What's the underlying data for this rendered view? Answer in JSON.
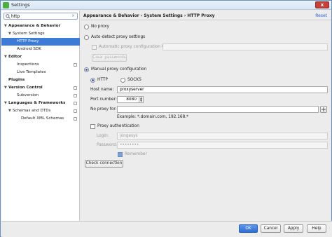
{
  "window": {
    "title": "Settings",
    "close_glyph": "x"
  },
  "search": {
    "value": "http",
    "icon": "search-icon",
    "clear_glyph": "×"
  },
  "tree": [
    {
      "label": "Appearance & Behavior",
      "arrow": "▼",
      "bold": true
    },
    {
      "label": "System Settings",
      "arrow": "▼",
      "bold": false
    },
    {
      "label": "HTTP Proxy",
      "arrow": "",
      "bold": false,
      "selected": true
    },
    {
      "label": "Android SDK",
      "arrow": "",
      "bold": false
    },
    {
      "label": "Editor",
      "arrow": "▼",
      "bold": true
    },
    {
      "label": "Inspections",
      "arrow": "",
      "bold": false,
      "badge": true
    },
    {
      "label": "Live Templates",
      "arrow": "",
      "bold": false
    },
    {
      "label": "Plugins",
      "arrow": "",
      "bold": true
    },
    {
      "label": "Version Control",
      "arrow": "▼",
      "bold": true,
      "badge": true
    },
    {
      "label": "Subversion",
      "arrow": "",
      "bold": false,
      "badge": true
    },
    {
      "label": "Languages & Frameworks",
      "arrow": "▼",
      "bold": true,
      "badge": true
    },
    {
      "label": "Schemas and DTDs",
      "arrow": "▼",
      "bold": false,
      "badge": true
    },
    {
      "label": "Default XML Schemas",
      "arrow": "",
      "bold": false,
      "badge": true
    }
  ],
  "breadcrumb": "Appearance & Behavior › System Settings › HTTP Proxy",
  "reset_label": "Reset",
  "proxy": {
    "no_proxy_label": "No proxy",
    "auto_detect_label": "Auto-detect proxy settings",
    "auto_config_label": "Automatic proxy configuration URL:",
    "auto_config_value": "",
    "clear_passwords_label": "Clear passwords",
    "manual_label": "Manual proxy configuration",
    "http_label": "HTTP",
    "socks_label": "SOCKS",
    "host_label": "Host name:",
    "host_value": "proxyserver",
    "port_label": "Port number:",
    "port_value": "8080",
    "no_proxy_for_label": "No proxy for:",
    "no_proxy_for_value": "",
    "example_text": "Example: *.domain.com, 192.168.*",
    "auth_label": "Proxy authentication",
    "login_label": "Login:",
    "login_value": "jongesys",
    "password_label": "Password:",
    "password_value": "••••••••",
    "remember_label": "Remember",
    "check_connection_label": "Check connection",
    "selected_mode": "manual",
    "selected_protocol": "http"
  },
  "footer": {
    "ok_label": "OK",
    "cancel_label": "Cancel",
    "apply_label": "Apply",
    "help_label": "Help"
  }
}
